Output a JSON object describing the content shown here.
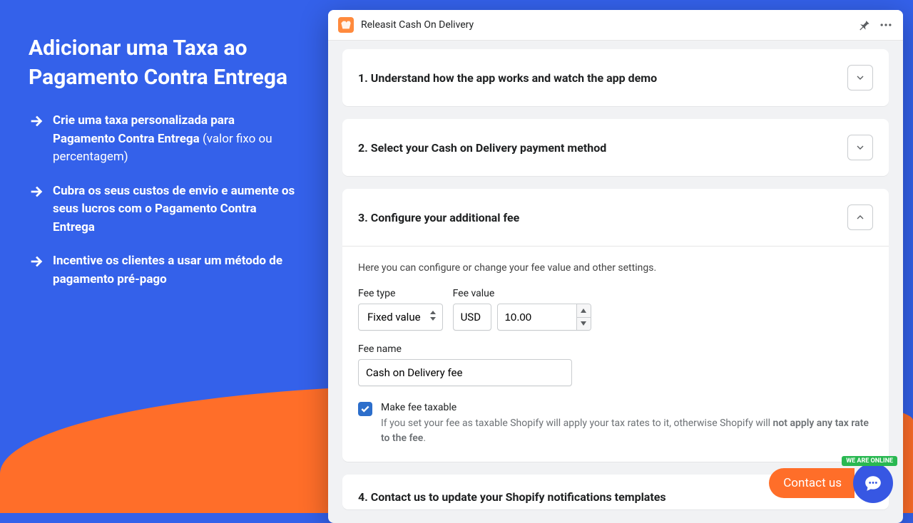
{
  "left": {
    "heading": "Adicionar uma Taxa ao Pagamento Contra Entrega",
    "bullets": [
      {
        "bold": "Crie uma taxa personalizada para Pagamento Contra Entrega",
        "rest": " (valor fixo ou percentagem)"
      },
      {
        "bold": "Cubra os seus custos de envio e aumente os seus lucros com o Pagamento Contra Entrega",
        "rest": ""
      },
      {
        "bold": "Incentive os clientes a usar um método de pagamento pré-pago",
        "rest": ""
      }
    ]
  },
  "app": {
    "title": "Releasit Cash On Delivery"
  },
  "steps": {
    "s1": "1. Understand how the app works and watch the app demo",
    "s2": "2. Select your Cash on Delivery payment method",
    "s3": "3. Configure your additional fee",
    "s4": "4. Contact us to update your Shopify notifications templates"
  },
  "config": {
    "intro": "Here you can configure or change your fee value and other settings.",
    "fee_type_label": "Fee type",
    "fee_type_value": "Fixed value",
    "fee_value_label": "Fee value",
    "currency": "USD",
    "fee_value": "10.00",
    "fee_name_label": "Fee name",
    "fee_name_value": "Cash on Delivery fee",
    "taxable_label": "Make fee taxable",
    "taxable_help1": "If you set your fee as taxable Shopify will apply your tax rates to it, otherwise Shopify will ",
    "taxable_help_bold": "not apply any tax rate to the fee",
    "taxable_help2": "."
  },
  "contact": {
    "label": "Contact us",
    "badge": "WE ARE ONLINE"
  }
}
